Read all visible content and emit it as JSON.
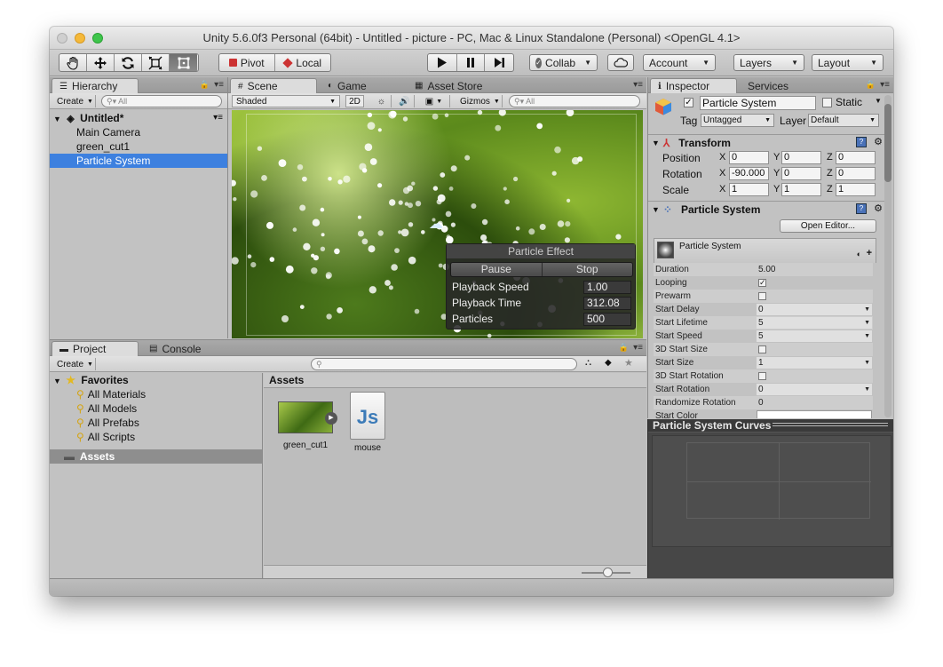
{
  "window": {
    "title": "Unity 5.6.0f3 Personal (64bit) - Untitled - picture - PC, Mac & Linux Standalone (Personal) <OpenGL 4.1>"
  },
  "toolbar": {
    "pivot": "Pivot",
    "local": "Local",
    "collab": "Collab",
    "account": "Account",
    "layers": "Layers",
    "layout": "Layout"
  },
  "hierarchy": {
    "tab": "Hierarchy",
    "create": "Create",
    "search_placeholder": "All",
    "scene_name": "Untitled*",
    "items": [
      "Main Camera",
      "green_cut1",
      "Particle System"
    ],
    "selected_index": 2
  },
  "scene": {
    "tabs": [
      "Scene",
      "Game",
      "Asset Store"
    ],
    "shading": "Shaded",
    "mode_2d": "2D",
    "gizmos": "Gizmos",
    "search_placeholder": "All"
  },
  "particle_effect": {
    "title": "Particle Effect",
    "pause": "Pause",
    "stop": "Stop",
    "rows": [
      {
        "label": "Playback Speed",
        "value": "1.00"
      },
      {
        "label": "Playback Time",
        "value": "312.08"
      },
      {
        "label": "Particles",
        "value": "500"
      }
    ]
  },
  "inspector": {
    "tabs": [
      "Inspector",
      "Services"
    ],
    "object_name": "Particle System",
    "static_label": "Static",
    "tag_label": "Tag",
    "tag_value": "Untagged",
    "layer_label": "Layer",
    "layer_value": "Default",
    "transform": {
      "title": "Transform",
      "position": {
        "label": "Position",
        "x": "0",
        "y": "0",
        "z": "0"
      },
      "rotation": {
        "label": "Rotation",
        "x": "-90.000",
        "y": "0",
        "z": "0"
      },
      "scale": {
        "label": "Scale",
        "x": "1",
        "y": "1",
        "z": "1"
      }
    },
    "particle_system": {
      "title": "Particle System",
      "open_editor": "Open Editor...",
      "module_title": "Particle System",
      "properties": [
        {
          "label": "Duration",
          "value": "5.00",
          "kind": "text"
        },
        {
          "label": "Looping",
          "value": "✓",
          "kind": "check",
          "checked": true
        },
        {
          "label": "Prewarm",
          "value": "",
          "kind": "check",
          "checked": false
        },
        {
          "label": "Start Delay",
          "value": "0",
          "kind": "dropdown"
        },
        {
          "label": "Start Lifetime",
          "value": "5",
          "kind": "dropdown"
        },
        {
          "label": "Start Speed",
          "value": "5",
          "kind": "dropdown"
        },
        {
          "label": "3D Start Size",
          "value": "",
          "kind": "check",
          "checked": false
        },
        {
          "label": "Start Size",
          "value": "1",
          "kind": "dropdown"
        },
        {
          "label": "3D Start Rotation",
          "value": "",
          "kind": "check",
          "checked": false
        },
        {
          "label": "Start Rotation",
          "value": "0",
          "kind": "dropdown"
        },
        {
          "label": "Randomize Rotation",
          "value": "0",
          "kind": "text"
        },
        {
          "label": "Start Color",
          "value": "",
          "kind": "color"
        }
      ]
    },
    "curves_title": "Particle System Curves"
  },
  "project": {
    "tabs": [
      "Project",
      "Console"
    ],
    "create": "Create",
    "favorites_label": "Favorites",
    "favorites": [
      "All Materials",
      "All Models",
      "All Prefabs",
      "All Scripts"
    ],
    "assets_folder": "Assets",
    "breadcrumb": "Assets",
    "assets": [
      {
        "name": "green_cut1",
        "type": "image"
      },
      {
        "name": "mouse",
        "type": "script"
      }
    ]
  },
  "colors": {
    "selection": "#3d80df",
    "panel_bg": "#c2c2c2",
    "dark_panel": "#474747"
  }
}
